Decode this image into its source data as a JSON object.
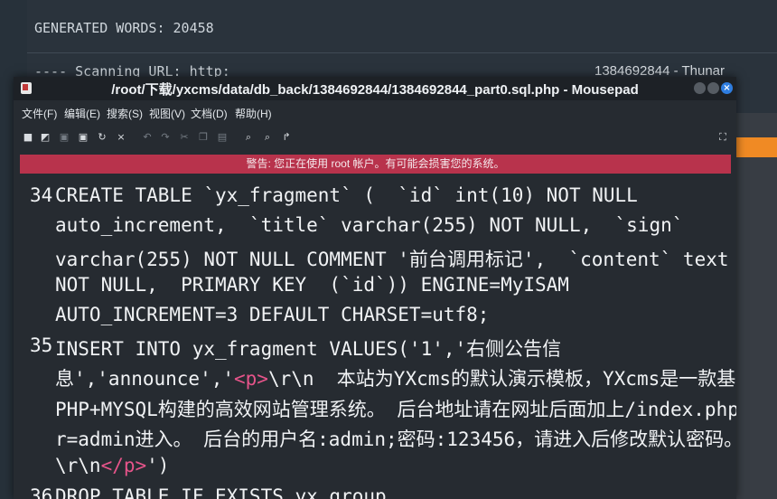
{
  "terminal": {
    "line1": "GENERATED WORDS: 20458",
    "line2": "---- Scanning URL: http:",
    "thunar_title": "1384692844 - Thunar"
  },
  "window": {
    "title": "/root/下载/yxcms/data/db_back/1384692844/1384692844_part0.sql.php - Mousepad",
    "close_glyph": "×"
  },
  "menu": {
    "file": "文件(F)",
    "edit": "编辑(E)",
    "search": "搜索(S)",
    "view": "视图(V)",
    "document": "文档(D)",
    "help": "帮助(H)"
  },
  "toolbar": {
    "new_icon": "new-document-icon",
    "new_window_icon": "new-window-icon",
    "open_icon": "open-icon",
    "save_icon": "save-icon",
    "save_as_icon": "save-as-icon",
    "reload_icon": "reload-icon",
    "close_icon": "close-icon",
    "undo_icon": "undo-icon",
    "redo_icon": "redo-icon",
    "cut_icon": "cut-icon",
    "copy_icon": "copy-icon",
    "paste_icon": "paste-icon",
    "find_icon": "find-icon",
    "find_replace_icon": "find-replace-icon",
    "goto_icon": "go-to-icon",
    "fullscreen_icon": "fullscreen-icon"
  },
  "warning": "警告: 您正在使用 root 帐户。有可能会损害您的系统。",
  "editor": {
    "line34_num": "34",
    "line35_num": "35",
    "line36_num": "36",
    "l34a": "CREATE TABLE `yx_fragment` (  `id` int(10) NOT NULL",
    "l34b": "auto_increment,  `title` varchar(255) NOT NULL,  `sign`",
    "l34c": "varchar(255) NOT NULL COMMENT '前台调用标记',  `content` text",
    "l34d": "NOT NULL,  PRIMARY KEY  (`id`)) ENGINE=MyISAM",
    "l34e": "AUTO_INCREMENT=3 DEFAULT CHARSET=utf8;",
    "l35a": "INSERT INTO yx_fragment VALUES('1','右侧公告信",
    "l35b_pre": "息','announce','",
    "l35b_tag": "<p>",
    "l35b_post": "\\r\\n  本站为YXcms的默认演示模板，YXcms是一款基于",
    "l35c": "PHP+MYSQL构建的高效网站管理系统。 后台地址请在网址后面加上/index.php?",
    "l35d": "r=admin进入。 后台的用户名:admin;密码:123456，请进入后修改默认密码。",
    "l35e_pre": "\\r\\n",
    "l35e_tag": "</p>",
    "l35e_post": "')",
    "l36": "DROP TABLE IF EXISTS yx_group"
  }
}
